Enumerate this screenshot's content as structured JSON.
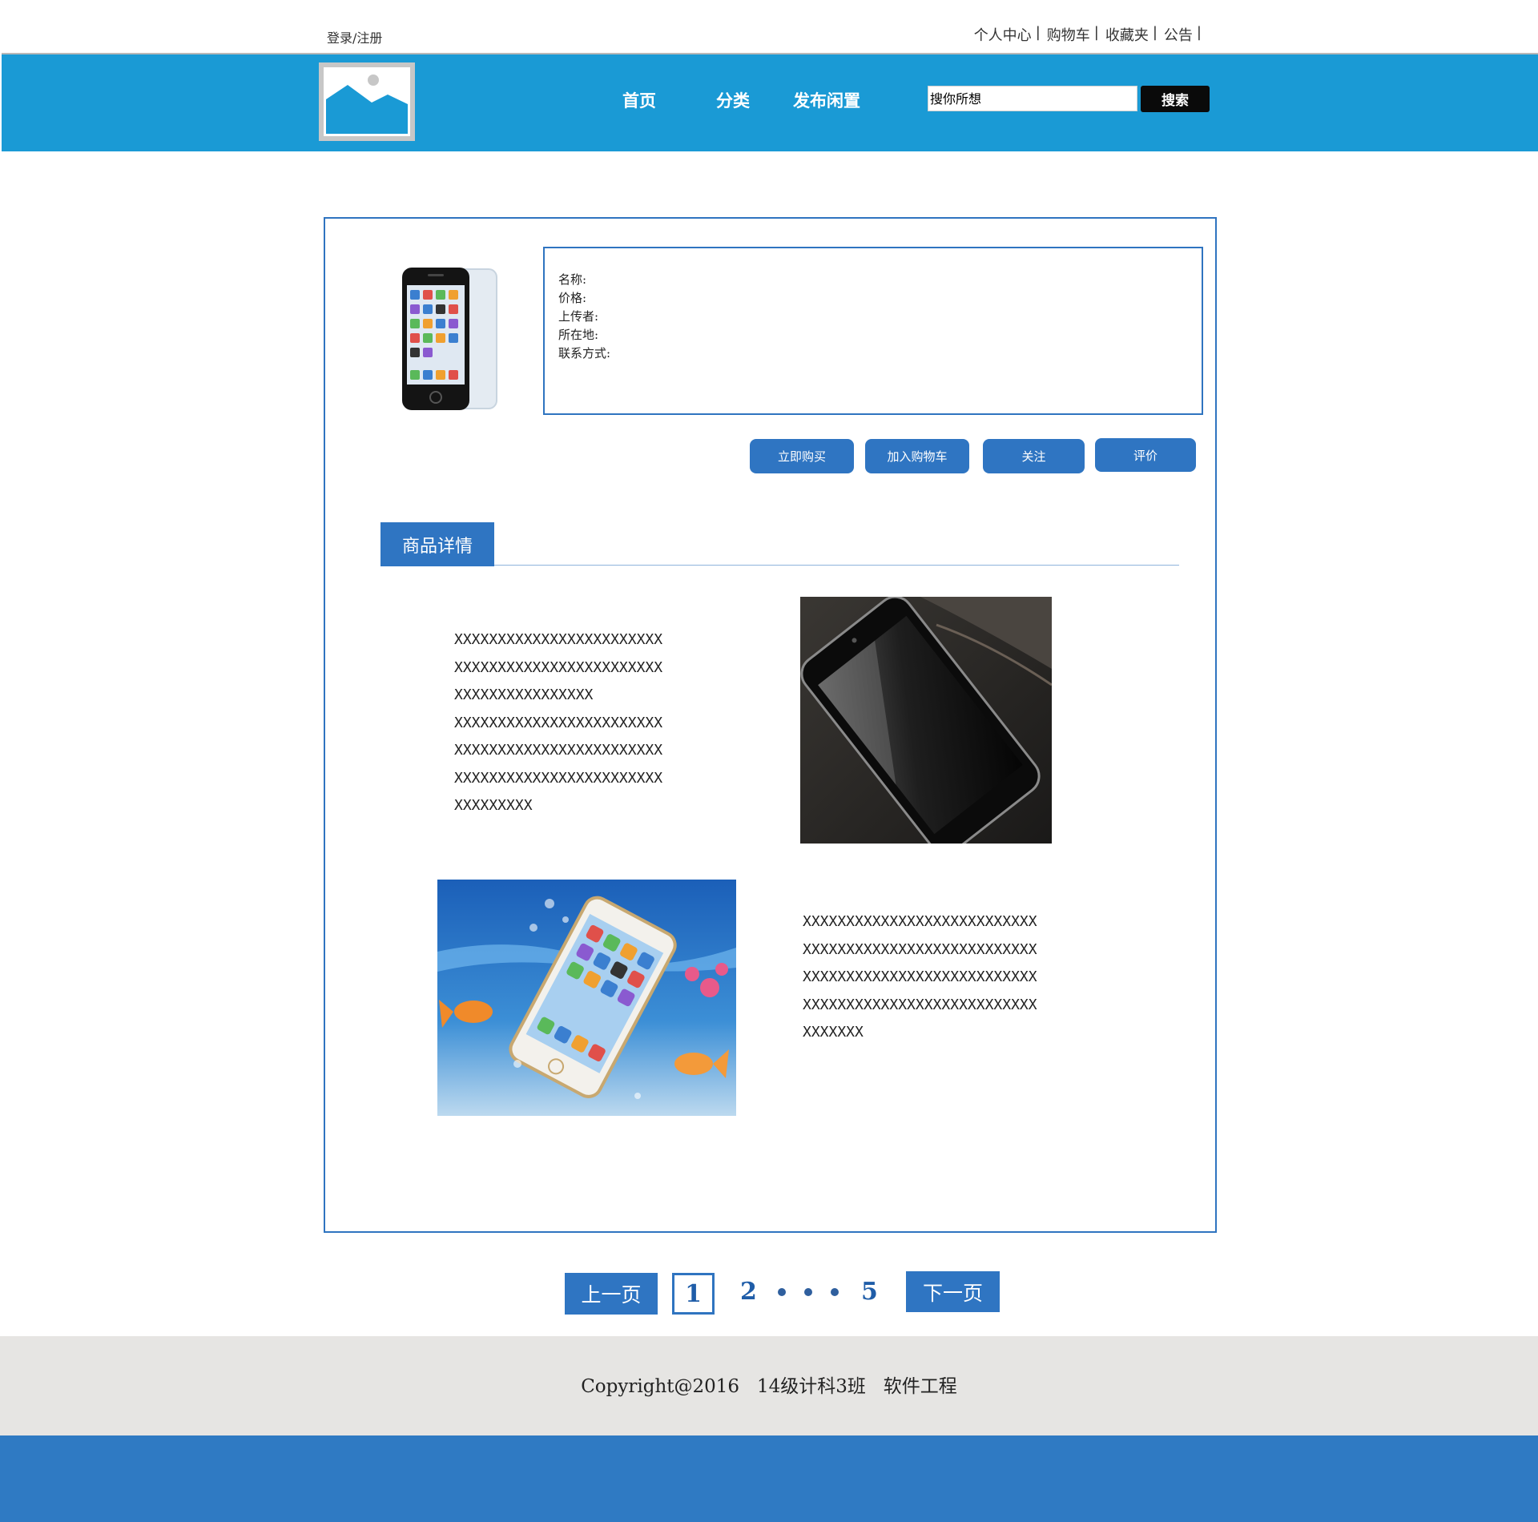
{
  "topbar": {
    "login_label": "登录/注册",
    "links": [
      "个人中心",
      "购物车",
      "收藏夹",
      "公告"
    ],
    "separator": "|"
  },
  "header": {
    "nav": [
      "首页",
      "分类",
      "发布闲置"
    ],
    "search_placeholder": "搜你所想",
    "search_button": "搜索"
  },
  "product": {
    "fields": [
      "名称:",
      "价格:",
      "上传者:",
      "所在地:",
      "联系方式:"
    ],
    "actions": [
      "立即购买",
      "加入购物车",
      "关注",
      "评价"
    ]
  },
  "details": {
    "tab_label": "商品详情",
    "para1": [
      "XXXXXXXXXXXXXXXXXXXXXXXX",
      "XXXXXXXXXXXXXXXXXXXXXXXX",
      "XXXXXXXXXXXXXXXX",
      "XXXXXXXXXXXXXXXXXXXXXXXX",
      "XXXXXXXXXXXXXXXXXXXXXXXX",
      "XXXXXXXXXXXXXXXXXXXXXXXX",
      "XXXXXXXXX"
    ],
    "para2": [
      "XXXXXXXXXXXXXXXXXXXXXXXXXXX",
      "XXXXXXXXXXXXXXXXXXXXXXXXXXX",
      "XXXXXXXXXXXXXXXXXXXXXXXXXXX",
      "XXXXXXXXXXXXXXXXXXXXXXXXXXX",
      "XXXXXXX"
    ]
  },
  "pagination": {
    "prev": "上一页",
    "next": "下一页",
    "current": "1",
    "page_2": "2",
    "last": "5"
  },
  "footer": {
    "copyright": "Copyright@2016   14级计科3班   软件工程"
  },
  "colors": {
    "header_blue": "#1a9ad5",
    "accent_blue": "#2f75c2",
    "footer_gray": "#e6e5e3",
    "bottom_blue": "#2f7ac3"
  }
}
